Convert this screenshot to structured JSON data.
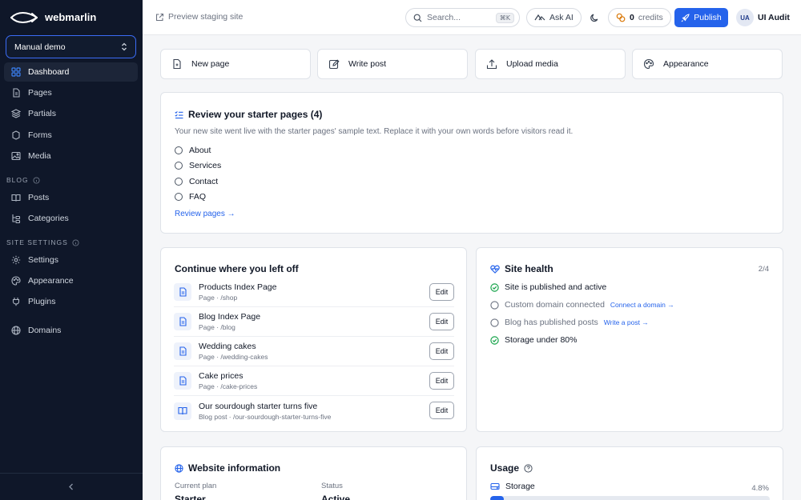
{
  "app": {
    "name": "webmarlin"
  },
  "sidebar": {
    "site_select": "Manual demo",
    "items": [
      {
        "label": "Dashboard",
        "icon": "dashboard-icon"
      },
      {
        "label": "Pages",
        "icon": "pages-icon"
      },
      {
        "label": "Partials",
        "icon": "layers-icon"
      },
      {
        "label": "Forms",
        "icon": "forms-icon"
      },
      {
        "label": "Media",
        "icon": "image-icon"
      },
      {
        "label": "Posts",
        "icon": "book-icon"
      },
      {
        "label": "Categories",
        "icon": "categories-icon"
      },
      {
        "label": "Settings",
        "icon": "gear-icon"
      },
      {
        "label": "Appearance",
        "icon": "palette-icon"
      },
      {
        "label": "Plugins",
        "icon": "plug-icon"
      },
      {
        "label": "Domains",
        "icon": "globe-icon"
      }
    ],
    "sections": {
      "blog": "BLOG",
      "site_settings": "SITE SETTINGS"
    }
  },
  "header": {
    "preview": "Preview staging site",
    "search_placeholder": "Search...",
    "search_shortcut": "⌘K",
    "ask_ai": "Ask AI",
    "credits_count": "0",
    "credits_label": "credits",
    "publish": "Publish",
    "avatar_initials": "UA",
    "user_name": "UI Audit"
  },
  "quick_actions": [
    {
      "label": "New page",
      "icon": "new-page-icon"
    },
    {
      "label": "Write post",
      "icon": "edit-icon"
    },
    {
      "label": "Upload media",
      "icon": "upload-icon"
    },
    {
      "label": "Appearance",
      "icon": "palette-icon"
    }
  ],
  "starter": {
    "title": "Review your starter pages (4)",
    "description": "Your new site went live with the starter pages' sample text. Replace it with your own words before visitors read it.",
    "pages": [
      "About",
      "Services",
      "Contact",
      "FAQ"
    ],
    "link": "Review pages →"
  },
  "recent": {
    "title": "Continue where you left off",
    "edit_label": "Edit",
    "items": [
      {
        "title": "Products Index Page",
        "sub": "Page · /shop",
        "icon": "document-icon"
      },
      {
        "title": "Blog Index Page",
        "sub": "Page · /blog",
        "icon": "document-icon"
      },
      {
        "title": "Wedding cakes",
        "sub": "Page · /wedding-cakes",
        "icon": "document-icon"
      },
      {
        "title": "Cake prices",
        "sub": "Page · /cake-prices",
        "icon": "document-icon"
      },
      {
        "title": "Our sourdough starter turns five",
        "sub": "Blog post · /our-sourdough-starter-turns-five",
        "icon": "book-icon"
      }
    ]
  },
  "health": {
    "title": "Site health",
    "score": "2/4",
    "items": [
      {
        "label": "Site is published and active",
        "done": true,
        "link": ""
      },
      {
        "label": "Custom domain connected",
        "done": false,
        "link": "Connect a domain →"
      },
      {
        "label": "Blog has published posts",
        "done": false,
        "link": "Write a post →"
      },
      {
        "label": "Storage under 80%",
        "done": true,
        "link": ""
      }
    ]
  },
  "website_info": {
    "title": "Website information",
    "plan_label": "Current plan",
    "plan_value": "Starter",
    "status_label": "Status",
    "status_value": "Active"
  },
  "usage": {
    "title": "Usage",
    "storage_label": "Storage",
    "storage_percent": "4.8%",
    "storage_fraction": 0.048
  },
  "colors": {
    "accent": "#2563eb",
    "sidebar_bg": "#0f1729",
    "success": "#16a34a"
  }
}
